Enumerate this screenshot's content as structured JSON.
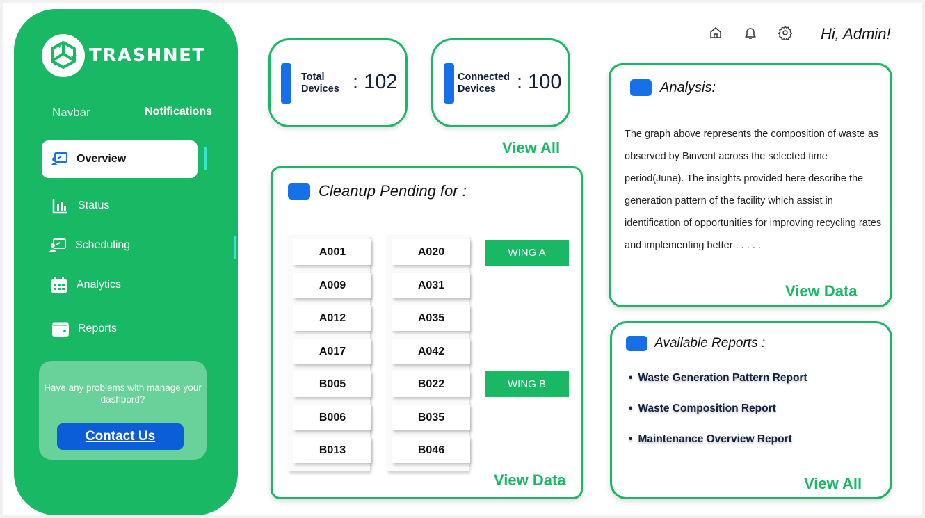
{
  "brand": {
    "name": "TRASHNET"
  },
  "sidebar": {
    "headings": {
      "navbar": "Navbar",
      "notifications": "Notifications"
    },
    "items": [
      {
        "label": "Overview",
        "icon": "presentation-icon",
        "active": true
      },
      {
        "label": "Status",
        "icon": "bar-chart-icon"
      },
      {
        "label": "Scheduling",
        "icon": "presentation-icon"
      },
      {
        "label": "Analytics",
        "icon": "calendar-icon"
      },
      {
        "label": "Reports",
        "icon": "wallet-icon"
      }
    ],
    "help": {
      "text": "Have any problems with manage your dashbord?",
      "button": "Contact Us"
    }
  },
  "topbar": {
    "icons": [
      "home-icon",
      "bell-icon",
      "gear-icon"
    ],
    "greeting": "Hi, Admin!"
  },
  "stats": [
    {
      "label_line1": "Total",
      "label_line2": "Devices",
      "value": ": 102"
    },
    {
      "label_line1": "Connected",
      "label_line2": "Devices",
      "value": ": 100"
    }
  ],
  "stats_link": "View All",
  "cleanup": {
    "title": "Cleanup Pending for :",
    "column1": [
      "A001",
      "A009",
      "A012",
      "A017",
      "B005",
      "B006",
      "B013"
    ],
    "column2": [
      "A020",
      "A031",
      "A035",
      "A042",
      "B022",
      "B035",
      "B046"
    ],
    "wings": [
      "WING A",
      "WING B"
    ],
    "link": "View Data"
  },
  "analysis": {
    "title": "Analysis:",
    "text": "The graph above represents the composition of waste as observed by Binvent across the selected time period(June). The insights provided here describe the generation pattern of the facility which assist in identification of opportunities for improving recycling rates and implementing better . . . . .",
    "link": "View Data"
  },
  "reports": {
    "title": "Available Reports :",
    "items": [
      "Waste Generation Pattern Report",
      "Waste Composition Report",
      "Maintenance Overview Report"
    ],
    "link": "View All"
  },
  "colors": {
    "primary_green": "#19b865",
    "accent_blue": "#1671e8",
    "button_blue": "#0b5ed7"
  }
}
